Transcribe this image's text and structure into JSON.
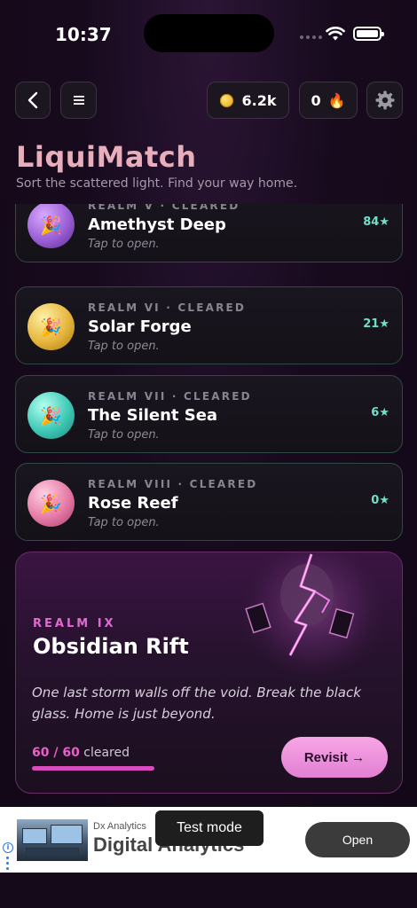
{
  "status_bar": {
    "time": "10:37"
  },
  "header": {
    "coins": "6.2k",
    "streak": "0",
    "streak_icon": "🔥"
  },
  "app": {
    "title": "LiquiMatch",
    "subtitle": "Sort the scattered light. Find your way home."
  },
  "realms": [
    {
      "tag": "REALM V · CLEARED",
      "name": "Amethyst Deep",
      "hint": "Tap to open.",
      "stars": "84★",
      "orb_color": "#9b5fd6",
      "icon": "party-popper"
    },
    {
      "tag": "REALM VI · CLEARED",
      "name": "Solar Forge",
      "hint": "Tap to open.",
      "stars": "21★",
      "orb_color": "#e6b63c",
      "icon": "party-popper"
    },
    {
      "tag": "REALM VII · CLEARED",
      "name": "The Silent Sea",
      "hint": "Tap to open.",
      "stars": "6★",
      "orb_color": "#3fc9b6",
      "icon": "party-popper"
    },
    {
      "tag": "REALM VIII · CLEARED",
      "name": "Rose Reef",
      "hint": "Tap to open.",
      "stars": "0★",
      "orb_color": "#e57aa6",
      "icon": "party-popper"
    }
  ],
  "featured": {
    "tag": "REALM IX",
    "name": "Obsidian Rift",
    "description": "One last storm walls off the void. Break the black glass. Home is just beyond.",
    "progress_num": "60 / 60",
    "progress_label": "cleared",
    "progress_fraction": 1.0,
    "button_label": "Revisit →"
  },
  "ad": {
    "brand": "Dx Analytics",
    "title": "Digital Analytics",
    "open_label": "Open",
    "test_mode": "Test mode"
  },
  "colors": {
    "title": "#e9aebb",
    "stars": "#6fe0c8",
    "accent": "#d94bbe"
  }
}
